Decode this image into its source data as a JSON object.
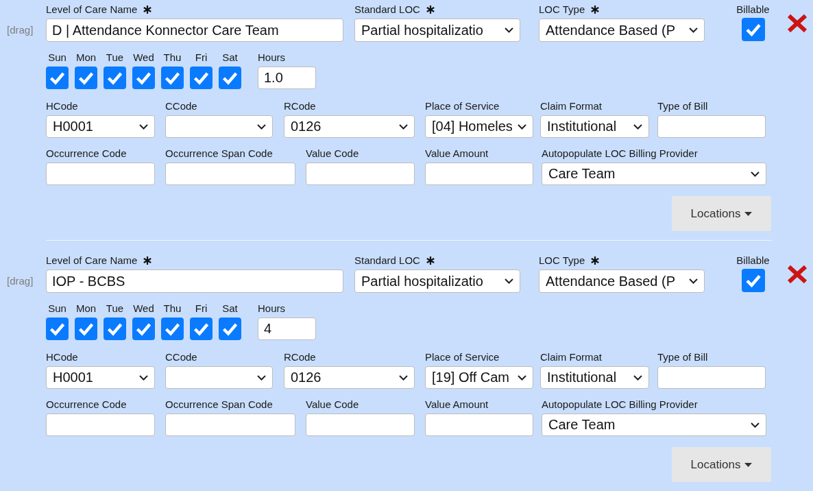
{
  "levels_of_care": [
    {
      "drag_handle": "[drag]",
      "main_fields": [
        {
          "kind": "input",
          "label": "Level of Care Name",
          "required": true,
          "value": "D | Attendance Konnector Care Team"
        },
        {
          "kind": "select",
          "label": "Standard LOC",
          "required": true,
          "value": "Partial hospitalizatio"
        },
        {
          "kind": "select",
          "label": "LOC Type",
          "required": true,
          "value": "Attendance Based (P"
        }
      ],
      "billable": {
        "label": "Billable",
        "checked": true
      },
      "days": [
        {
          "label": "Sun",
          "checked": true
        },
        {
          "label": "Mon",
          "checked": true
        },
        {
          "label": "Tue",
          "checked": true
        },
        {
          "label": "Wed",
          "checked": true
        },
        {
          "label": "Thu",
          "checked": true
        },
        {
          "label": "Fri",
          "checked": true
        },
        {
          "label": "Sat",
          "checked": true
        }
      ],
      "hours": {
        "label": "Hours",
        "value": "1.0"
      },
      "billing_fields": [
        {
          "kind": "select",
          "label": "HCode",
          "value": "H0001"
        },
        {
          "kind": "select",
          "label": "CCode"
        },
        {
          "kind": "select",
          "label": "RCode",
          "value": "0126"
        },
        {
          "kind": "select",
          "label": "Place of Service",
          "value": "[04] Homeles"
        },
        {
          "kind": "select",
          "label": "Claim Format",
          "value": "Institutional"
        },
        {
          "kind": "input",
          "label": "Type of Bill"
        }
      ],
      "claim_codes": [
        {
          "kind": "input",
          "label": "Occurrence Code"
        },
        {
          "kind": "input",
          "label": "Occurrence Span Code"
        },
        {
          "kind": "input",
          "label": "Value Code"
        },
        {
          "kind": "input",
          "label": "Value Amount"
        },
        {
          "kind": "select",
          "label": "Autopopulate LOC Billing Provider",
          "value": "Care Team"
        }
      ],
      "locations_button": "Locations"
    },
    {
      "drag_handle": "[drag]",
      "main_fields": [
        {
          "kind": "input",
          "label": "Level of Care Name",
          "required": true,
          "value": "IOP - BCBS"
        },
        {
          "kind": "select",
          "label": "Standard LOC",
          "required": true,
          "value": "Partial hospitalizatio"
        },
        {
          "kind": "select",
          "label": "LOC Type",
          "required": true,
          "value": "Attendance Based (P"
        }
      ],
      "billable": {
        "label": "Billable",
        "checked": true
      },
      "days": [
        {
          "label": "Sun",
          "checked": true
        },
        {
          "label": "Mon",
          "checked": true
        },
        {
          "label": "Tue",
          "checked": true
        },
        {
          "label": "Wed",
          "checked": true
        },
        {
          "label": "Thu",
          "checked": true
        },
        {
          "label": "Fri",
          "checked": true
        },
        {
          "label": "Sat",
          "checked": true
        }
      ],
      "hours": {
        "label": "Hours",
        "value": "4"
      },
      "billing_fields": [
        {
          "kind": "select",
          "label": "HCode",
          "value": "H0001"
        },
        {
          "kind": "select",
          "label": "CCode"
        },
        {
          "kind": "select",
          "label": "RCode",
          "value": "0126"
        },
        {
          "kind": "select",
          "label": "Place of Service",
          "value": "[19] Off Cam"
        },
        {
          "kind": "select",
          "label": "Claim Format",
          "value": "Institutional"
        },
        {
          "kind": "input",
          "label": "Type of Bill"
        }
      ],
      "claim_codes": [
        {
          "kind": "input",
          "label": "Occurrence Code"
        },
        {
          "kind": "input",
          "label": "Occurrence Span Code"
        },
        {
          "kind": "input",
          "label": "Value Code"
        },
        {
          "kind": "input",
          "label": "Value Amount"
        },
        {
          "kind": "select",
          "label": "Autopopulate LOC Billing Provider",
          "value": "Care Team"
        }
      ],
      "locations_button": "Locations"
    }
  ]
}
